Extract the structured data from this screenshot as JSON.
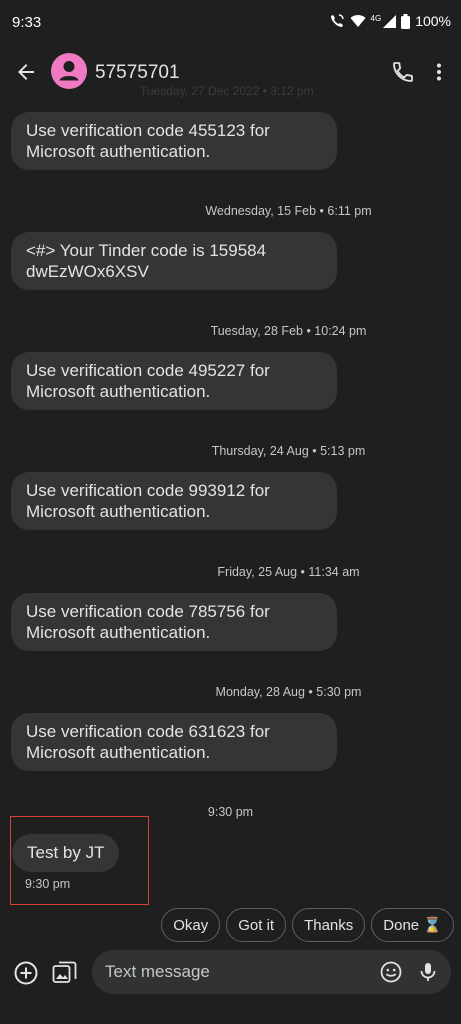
{
  "status_bar": {
    "time": "9:33",
    "battery": "100%",
    "network": "4G"
  },
  "header": {
    "title": "57575701",
    "partial_date": "Tuesday, 27 Dec 2022 • 3:12 pm"
  },
  "messages": [
    {
      "text": "Use verification code 455123 for\nMicrosoft authentication."
    },
    {
      "date": "Wednesday, 15 Feb • 6:11 pm",
      "text": "<#> Your Tinder code is 159584\ndwEzWOx6XSV"
    },
    {
      "date": "Tuesday, 28 Feb • 10:24 pm",
      "text": "Use verification code 495227 for\nMicrosoft authentication."
    },
    {
      "date": "Thursday, 24 Aug • 5:13 pm",
      "text": "Use verification code 993912 for\nMicrosoft authentication."
    },
    {
      "date": "Friday, 25 Aug • 11:34 am",
      "text": "Use verification code 785756 for\nMicrosoft authentication."
    },
    {
      "date": "Monday, 28 Aug • 5:30 pm",
      "text": "Use verification code 631623 for\nMicrosoft authentication."
    }
  ],
  "sent": {
    "date": "9:30 pm",
    "text": "Test by JT",
    "time": "9:30 pm"
  },
  "smart_replies": [
    "Okay",
    "Got it",
    "Thanks",
    "Done ⌛"
  ],
  "composer": {
    "placeholder": "Text message"
  },
  "colors": {
    "background": "#1f1f1f",
    "bubble": "#333537",
    "avatar": "#f07ac2",
    "highlight": "#d9423a"
  }
}
